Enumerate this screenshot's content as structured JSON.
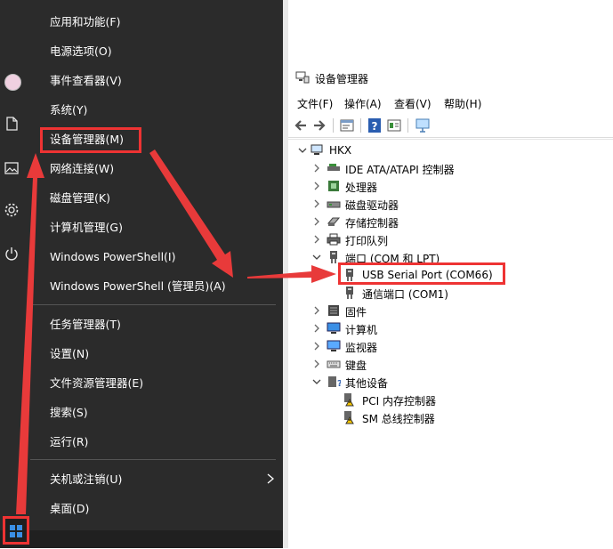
{
  "colors": {
    "menu_bg": "#2b2b2b",
    "menu_text": "#ffffff",
    "annotation_red": "#e83a3a",
    "win_blue": "#3b8fe5"
  },
  "start_menu": {
    "items": [
      {
        "label": "应用和功能(F)"
      },
      {
        "label": "电源选项(O)"
      },
      {
        "label": "事件查看器(V)"
      },
      {
        "label": "系统(Y)"
      },
      {
        "label": "设备管理器(M)",
        "highlighted": true
      },
      {
        "label": "网络连接(W)"
      },
      {
        "label": "磁盘管理(K)"
      },
      {
        "label": "计算机管理(G)"
      },
      {
        "label": "Windows PowerShell(I)"
      },
      {
        "label": "Windows PowerShell (管理员)(A)"
      },
      {
        "label": "任务管理器(T)"
      },
      {
        "label": "设置(N)"
      },
      {
        "label": "文件资源管理器(E)"
      },
      {
        "label": "搜索(S)"
      },
      {
        "label": "运行(R)"
      },
      {
        "label": "关机或注销(U)",
        "has_submenu": true,
        "icon": "chevron-right-icon"
      },
      {
        "label": "桌面(D)"
      }
    ]
  },
  "desktop_strip": {
    "icons": [
      "avatar",
      "document-icon",
      "image-icon",
      "gear-icon",
      "power-icon"
    ]
  },
  "taskbar": {
    "start_icon": "windows-logo-icon"
  },
  "device_manager": {
    "title": "设备管理器",
    "menu": [
      "文件(F)",
      "操作(A)",
      "查看(V)",
      "帮助(H)"
    ],
    "toolbar": [
      "back-arrow-icon",
      "forward-arrow-icon",
      "properties-icon",
      "help-icon",
      "view-icon",
      "monitor-icon"
    ],
    "tree": [
      {
        "label": "HKX",
        "level": 0,
        "expanded": true,
        "icon": "computer-icon"
      },
      {
        "label": "IDE ATA/ATAPI 控制器",
        "level": 1,
        "expanded": false,
        "icon": "ide-controller-icon"
      },
      {
        "label": "处理器",
        "level": 1,
        "expanded": false,
        "icon": "processor-icon"
      },
      {
        "label": "磁盘驱动器",
        "level": 1,
        "expanded": false,
        "icon": "disk-drive-icon"
      },
      {
        "label": "存储控制器",
        "level": 1,
        "expanded": false,
        "icon": "storage-controller-icon"
      },
      {
        "label": "打印队列",
        "level": 1,
        "expanded": false,
        "icon": "printer-icon"
      },
      {
        "label": "端口 (COM 和 LPT)",
        "level": 1,
        "expanded": true,
        "icon": "port-icon"
      },
      {
        "label": "USB Serial Port (COM66)",
        "level": 2,
        "icon": "port-icon",
        "highlighted": true
      },
      {
        "label": "通信端口 (COM1)",
        "level": 2,
        "icon": "port-icon"
      },
      {
        "label": "固件",
        "level": 1,
        "expanded": false,
        "icon": "firmware-icon"
      },
      {
        "label": "计算机",
        "level": 1,
        "expanded": false,
        "icon": "computer-monitor-icon"
      },
      {
        "label": "监视器",
        "level": 1,
        "expanded": false,
        "icon": "monitor-icon"
      },
      {
        "label": "键盘",
        "level": 1,
        "expanded": false,
        "icon": "keyboard-icon"
      },
      {
        "label": "其他设备",
        "level": 1,
        "expanded": true,
        "icon": "other-devices-icon"
      },
      {
        "label": "PCI 内存控制器",
        "level": 2,
        "icon": "warning-device-icon"
      },
      {
        "label": "SM 总线控制器",
        "level": 2,
        "icon": "warning-device-icon"
      }
    ]
  }
}
